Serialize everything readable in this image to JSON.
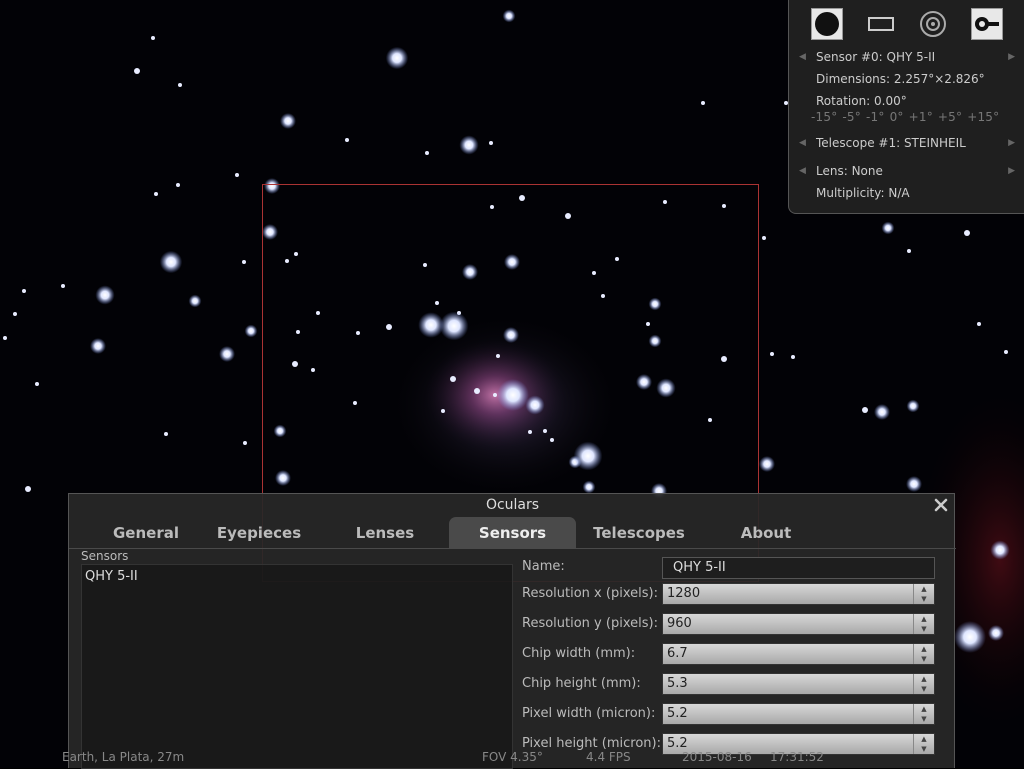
{
  "ocular_panel": {
    "tools": [
      {
        "name": "ccd-sensor-view-icon"
      },
      {
        "name": "telrad-rectangle-icon"
      },
      {
        "name": "eyepiece-target-icon"
      },
      {
        "name": "ocular-configuration-icon"
      }
    ],
    "sensor": "Sensor #0: QHY 5-II",
    "dimensions": "Dimensions: 2.257°×2.826°",
    "rotation": "Rotation: 0.00°",
    "rotation_steps": [
      "-15°",
      "-5°",
      "-1°",
      "0°",
      "+1°",
      "+5°",
      "+15°"
    ],
    "telescope": "Telescope #1: STEINHEIL",
    "lens": "Lens: None",
    "multiplicity": "Multiplicity: N/A"
  },
  "dialog": {
    "title": "Oculars",
    "tabs": [
      "General",
      "Eyepieces",
      "Lenses",
      "Sensors",
      "Telescopes",
      "About"
    ],
    "active_tab": "Sensors",
    "list_label": "Sensors",
    "list_items": [
      "QHY 5-II"
    ],
    "fields": [
      {
        "label": "Name:",
        "value": "QHY 5-II"
      },
      {
        "label": "Resolution x (pixels):",
        "value": "1280"
      },
      {
        "label": "Resolution y (pixels):",
        "value": "960"
      },
      {
        "label": "Chip width (mm):",
        "value": "6.7"
      },
      {
        "label": "Chip height (mm):",
        "value": "5.3"
      },
      {
        "label": "Pixel width (micron):",
        "value": "5.2"
      },
      {
        "label": "Pixel height (micron):",
        "value": "5.2"
      }
    ]
  },
  "status": {
    "location": "Earth, La Plata, 27m",
    "fov": "FOV 4.35°",
    "fps": "4.4 FPS",
    "date": "2015-08-16",
    "time": "17:31:52"
  },
  "colors": {
    "sensor_frame": "#aa3333",
    "panel_bg": "#222222",
    "star_blue": "#b8c8ff",
    "nebula": "#c0508a"
  }
}
